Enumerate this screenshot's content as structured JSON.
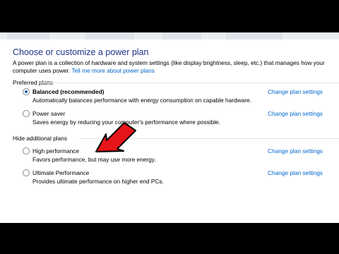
{
  "window": {
    "title": "Choose or customize a power plan",
    "description": "A power plan is a collection of hardware and system settings (like display brightness, sleep, etc.) that manages how your computer uses power.",
    "description_link": "Tell me more about power plans"
  },
  "preferred_header": "Preferred plans",
  "additional_header": "Hide additional plans",
  "plans": [
    {
      "name": "Balanced (recommended)",
      "description": "Automatically balances performance with energy consumption on capable hardware.",
      "selected": true,
      "change_label": "Change plan settings"
    },
    {
      "name": "Power saver",
      "description": "Saves energy by reducing your computer's performance where possible.",
      "selected": false,
      "change_label": "Change plan settings"
    },
    {
      "name": "High performance",
      "description": "Favors performance, but may use more energy.",
      "selected": false,
      "change_label": "Change plan settings"
    },
    {
      "name": "Ultimate Performance",
      "description": "Provides ultimate performance on higher end PCs.",
      "selected": false,
      "change_label": "Change plan settings"
    }
  ],
  "annotation": {
    "arrow_color": "#e8141b",
    "icon": "red-arrow-icon"
  }
}
